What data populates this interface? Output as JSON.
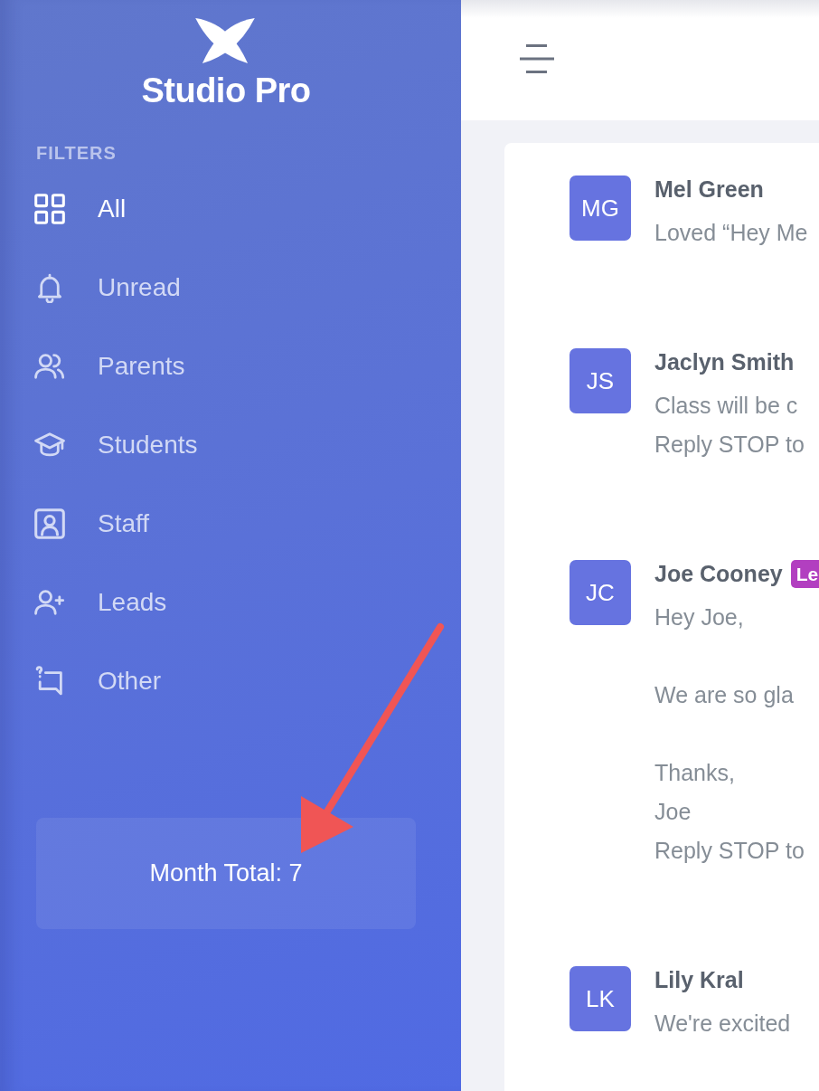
{
  "sidebar": {
    "brand": "Studio Pro",
    "section_title": "FILTERS",
    "items": [
      {
        "label": "All",
        "selected": true
      },
      {
        "label": "Unread",
        "selected": false
      },
      {
        "label": "Parents",
        "selected": false
      },
      {
        "label": "Students",
        "selected": false
      },
      {
        "label": "Staff",
        "selected": false
      },
      {
        "label": "Leads",
        "selected": false
      },
      {
        "label": "Other",
        "selected": false
      }
    ],
    "month_total": "Month Total: 7"
  },
  "messages": [
    {
      "initials": "MG",
      "name": "Mel Green",
      "paragraphs": [
        [
          "Loved “Hey Me"
        ]
      ]
    },
    {
      "initials": "JS",
      "name": "Jaclyn Smith",
      "paragraphs": [
        [
          "Class will be c",
          "Reply STOP to"
        ]
      ]
    },
    {
      "initials": "JC",
      "name": "Joe Cooney",
      "badge": {
        "label": "Le"
      },
      "paragraphs": [
        [
          "Hey Joe,"
        ],
        [
          "We are so gla"
        ],
        [
          "Thanks,",
          "Joe",
          "Reply STOP to"
        ]
      ]
    },
    {
      "initials": "LK",
      "name": "Lily Kral",
      "paragraphs": [
        [
          "We're excited"
        ]
      ]
    }
  ],
  "annotations": [
    {
      "kind": "arrow"
    }
  ]
}
